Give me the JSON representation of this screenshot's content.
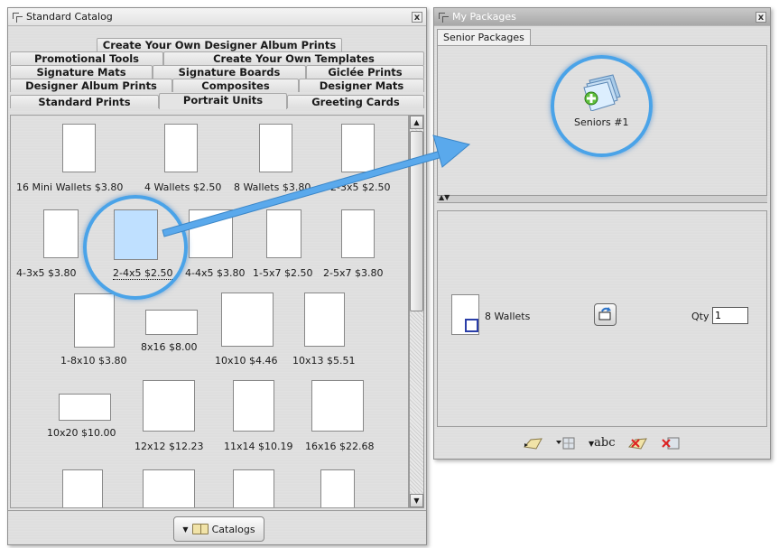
{
  "catalog": {
    "title": "Standard Catalog",
    "close": "x",
    "tab_rows": [
      [
        "Create Your Own Designer Album Prints"
      ],
      [
        "Promotional Tools",
        "Create Your Own Templates"
      ],
      [
        "Signature Mats",
        "Signature Boards",
        "Giclée Prints"
      ],
      [
        "Designer Album Prints",
        "Composites",
        "Designer Mats"
      ],
      [
        "Standard Prints",
        "Portrait Units",
        "Greeting Cards"
      ]
    ],
    "active_tab": "Portrait Units",
    "items": [
      "16 Mini Wallets $3.80",
      "4 Wallets $2.50",
      "8 Wallets $3.80",
      "2-3x5 $2.50",
      "4-3x5 $3.80",
      "2-4x5 $2.50",
      "4-4x5 $3.80",
      "1-5x7 $2.50",
      "2-5x7 $3.80",
      "1-8x10 $3.80",
      "8x16  $8.00",
      "10x10 $4.46",
      "10x13  $5.51",
      "10x20  $10.00",
      "12x12 $12.23",
      "11x14  $10.19",
      "16x16 $22.68"
    ],
    "selected_item": "2-4x5 $2.50",
    "catalogs_button": "Catalogs"
  },
  "packages": {
    "title": "My Packages",
    "close": "x",
    "tab": "Senior Packages",
    "package_name": "Seniors #1",
    "line_item": {
      "name": "8 Wallets",
      "qty_label": "Qty",
      "qty_value": "1"
    },
    "toolbar_icons": [
      "new-package-icon",
      "add-grid-icon",
      "rename-abc-icon",
      "delete-package-icon",
      "delete-grid-icon"
    ],
    "rename_label": "abc"
  },
  "colors": {
    "highlight": "#4aa3e8",
    "selected_thumb": "#bfe0ff",
    "arrow": "#5aa9ec"
  }
}
